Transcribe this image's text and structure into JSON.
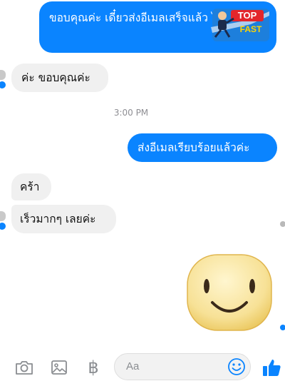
{
  "messages": [
    {
      "id": "msg1",
      "direction": "outgoing",
      "text": "ขอบคุณค่ะ เดี๋ยวส่งอีเมลเสร็จแล้ว ไปนะคะ"
    },
    {
      "id": "msg2",
      "direction": "incoming",
      "text": "ค่ะ  ขอบคุณค่ะ"
    },
    {
      "id": "msg3",
      "direction": "outgoing",
      "text": "ส่งอีเมลเรียบร้อยแล้วค่ะ"
    },
    {
      "id": "msg4",
      "direction": "incoming",
      "text": "คร้า"
    },
    {
      "id": "msg5",
      "direction": "incoming",
      "text": "เร็วมากๆ เลยค่ะ"
    }
  ],
  "timestamp": "3:00 PM",
  "stickers": {
    "top_fast": {
      "line1": "TOP",
      "line2": "FAST"
    },
    "smile": {
      "name": "smiley-face-sticker"
    }
  },
  "composer": {
    "placeholder": "Aa",
    "icons": [
      "camera-icon",
      "gallery-icon",
      "currency-icon",
      "emoji-icon",
      "thumbs-up-icon"
    ]
  },
  "colors": {
    "outgoing_bubble": "#0a84ff",
    "incoming_bubble": "#f0f0f0",
    "accent": "#0a84ff"
  }
}
